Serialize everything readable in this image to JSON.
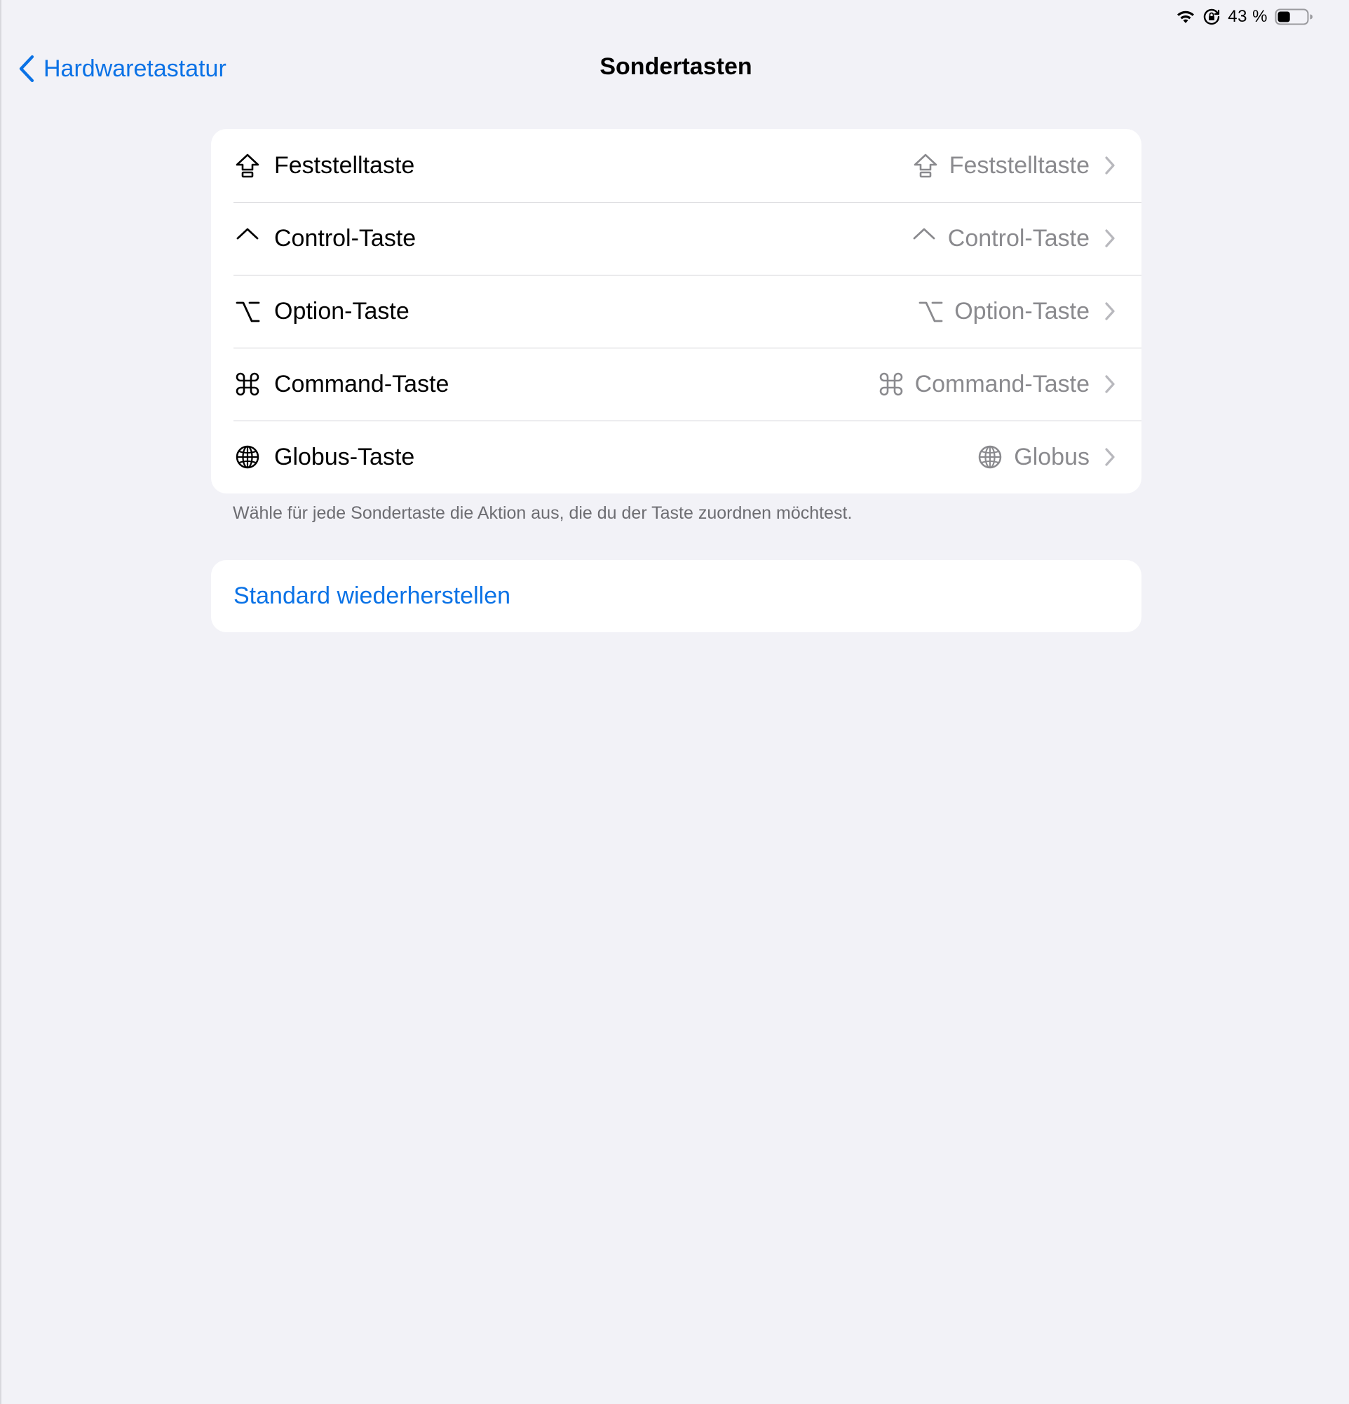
{
  "status_bar": {
    "battery_percent": "43 %",
    "battery_level": 0.43,
    "icons": [
      "wifi-icon",
      "orientation-lock-icon",
      "battery-icon"
    ]
  },
  "nav": {
    "back_label": "Hardwaretastatur",
    "title": "Sondertasten"
  },
  "modifier_keys": [
    {
      "label": "Feststelltaste",
      "icon": "caps-lock-icon",
      "value": "Feststelltaste",
      "value_icon": "caps-lock-icon"
    },
    {
      "label": "Control-Taste",
      "icon": "control-icon",
      "value": "Control-Taste",
      "value_icon": "control-icon"
    },
    {
      "label": "Option-Taste",
      "icon": "option-icon",
      "value": "Option-Taste",
      "value_icon": "option-icon"
    },
    {
      "label": "Command-Taste",
      "icon": "command-icon",
      "value": "Command-Taste",
      "value_icon": "command-icon"
    },
    {
      "label": "Globus-Taste",
      "icon": "globe-icon",
      "value": "Globus",
      "value_icon": "globe-icon"
    }
  ],
  "footer": "Wähle für jede Sondertaste die Aktion aus, die du der Taste zuordnen möchtest.",
  "restore_label": "Standard wiederherstellen",
  "colors": {
    "background": "#f2f2f7",
    "card": "#ffffff",
    "accent": "#0a72e6",
    "secondary_text": "#8a8a8e",
    "separator": "#d1d1d6"
  }
}
